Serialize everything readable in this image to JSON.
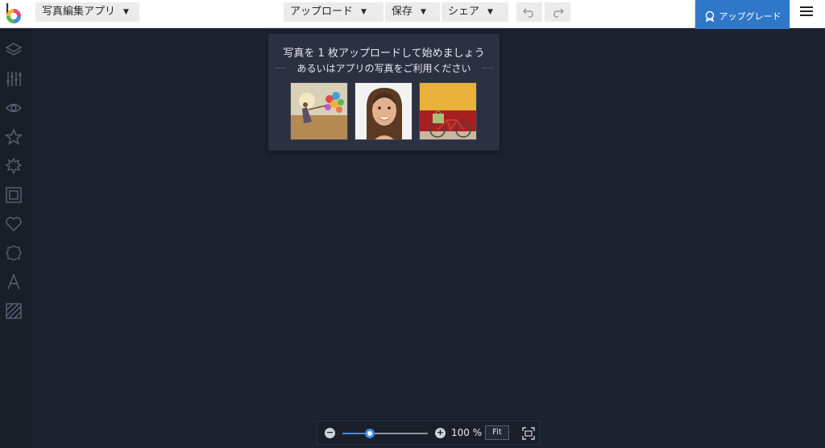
{
  "topbar": {
    "app_dropdown": "写真編集アプリ",
    "upload_menu": "アップロード",
    "save_menu": "保存",
    "share_menu": "シェア",
    "upgrade_button": "アップグレード"
  },
  "sidebar": {
    "tools": [
      {
        "icon": "layers-icon"
      },
      {
        "icon": "adjust-sliders-icon"
      },
      {
        "icon": "eye-icon"
      },
      {
        "icon": "star-icon"
      },
      {
        "icon": "texture-icon"
      },
      {
        "icon": "frame-icon"
      },
      {
        "icon": "heart-icon"
      },
      {
        "icon": "badge-icon"
      },
      {
        "icon": "text-icon"
      },
      {
        "icon": "pattern-icon"
      }
    ]
  },
  "popup": {
    "line1": "写真を 1 枚アップロードして始めましょう",
    "line2": "あるいはアプリの写真をご利用ください",
    "sample_photos": [
      "woman-with-balloons-photo",
      "smiling-woman-portrait-photo",
      "red-bicycle-photo"
    ]
  },
  "zoom": {
    "value_label": "100 %",
    "level_fraction": 0.32,
    "fit_label": "Fit"
  },
  "colors": {
    "accent_blue": "#2f78c9",
    "canvas_bg": "#1d2230",
    "sidebar_bg": "#1a1e28",
    "popup_bg": "#2c3142"
  }
}
